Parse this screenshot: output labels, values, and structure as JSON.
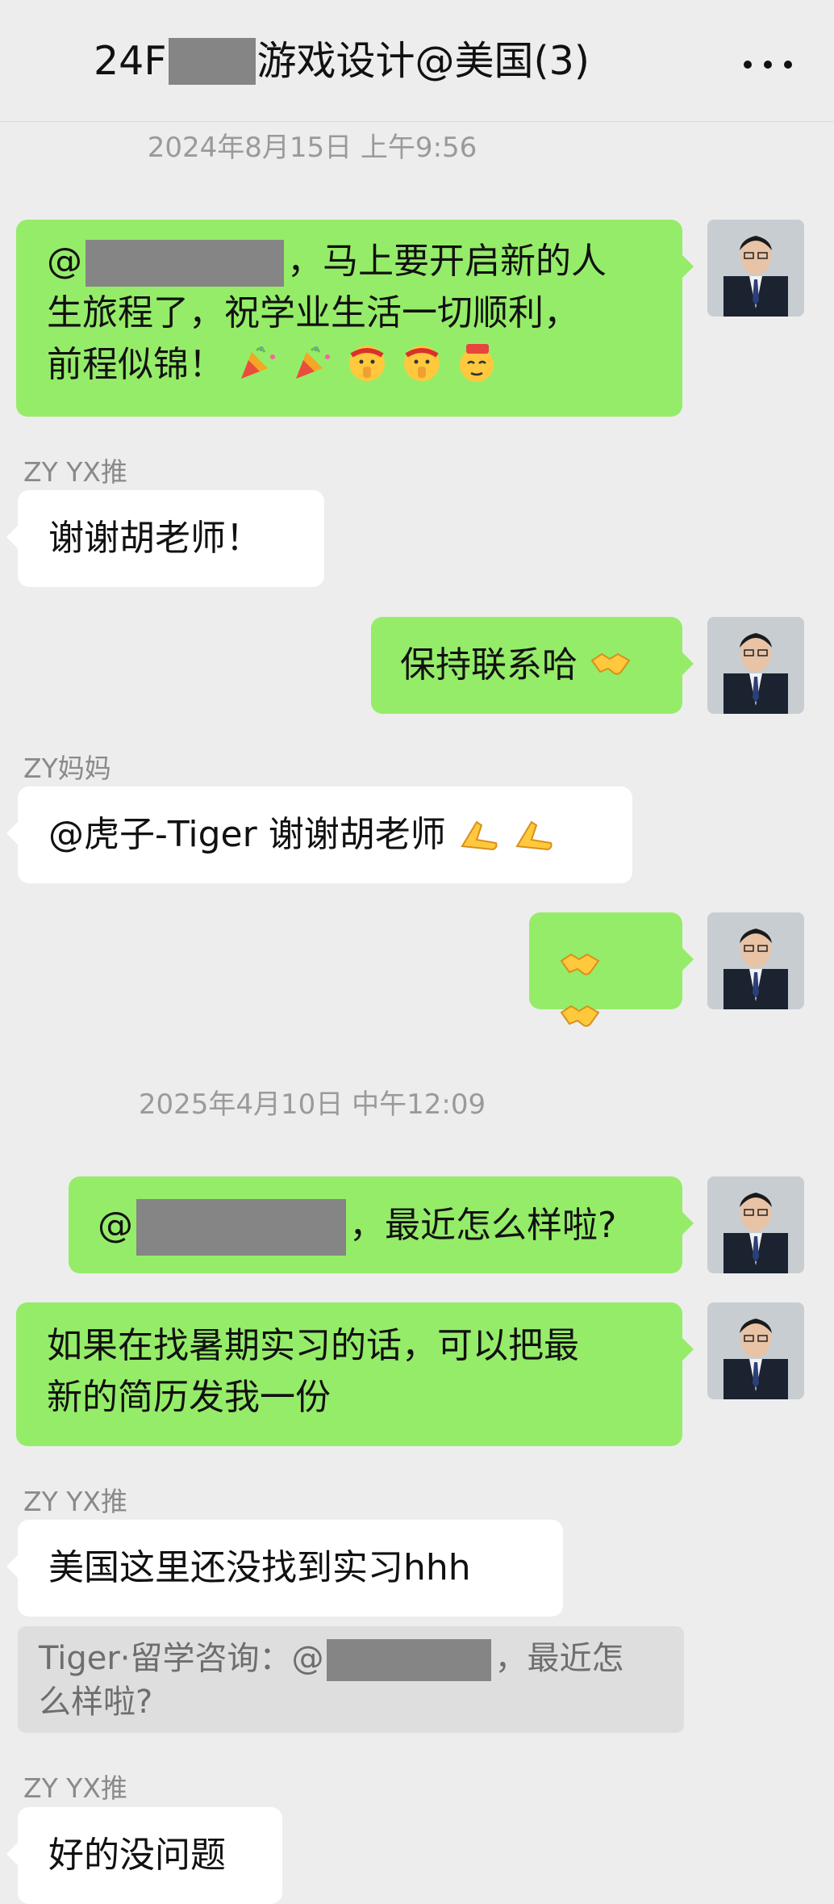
{
  "header": {
    "title_prefix": "24F",
    "title_suffix": "游戏设计@美国(3)",
    "more_icon": "more-dots-icon"
  },
  "timestamps": [
    "2024年8月15日 上午9:56",
    "2025年4月10日 中午12:09"
  ],
  "messages": [
    {
      "mentionPrefix": "@",
      "text_a": "，马上要开启新的人",
      "text_b": "生旅程了，祝学业生活一切顺利，",
      "text_c": "前程似锦！",
      "emojis": [
        "party-popper-icon",
        "party-popper-icon",
        "shush-face-icon",
        "shush-face-icon",
        "666-face-icon"
      ]
    },
    {
      "sender": "ZY YX推",
      "text": "谢谢胡老师！"
    },
    {
      "text": "保持联系哈",
      "emojis": [
        "handshake-icon"
      ]
    },
    {
      "sender": "ZY妈妈",
      "text": "@虎子-Tiger 谢谢胡老师",
      "emojis": [
        "pray-hands-icon",
        "pray-hands-icon"
      ]
    },
    {
      "emojis": [
        "handshake-icon",
        "handshake-icon"
      ]
    },
    {
      "mentionPrefix": "@",
      "text": "，最近怎么样啦?"
    },
    {
      "text_a": "如果在找暑期实习的话，可以把最",
      "text_b": "新的简历发我一份"
    },
    {
      "sender": "ZY YX推",
      "text": "美国这里还没找到实习hhh"
    },
    {
      "quote_a": "Tiger·留学咨询：@",
      "quote_b": "，最近怎",
      "quote_c": "么样啦?"
    },
    {
      "sender": "ZY YX推",
      "text": "好的没问题"
    }
  ],
  "colors": {
    "outgoing": "#95ec69",
    "incoming": "#ffffff",
    "background": "#ededed"
  }
}
